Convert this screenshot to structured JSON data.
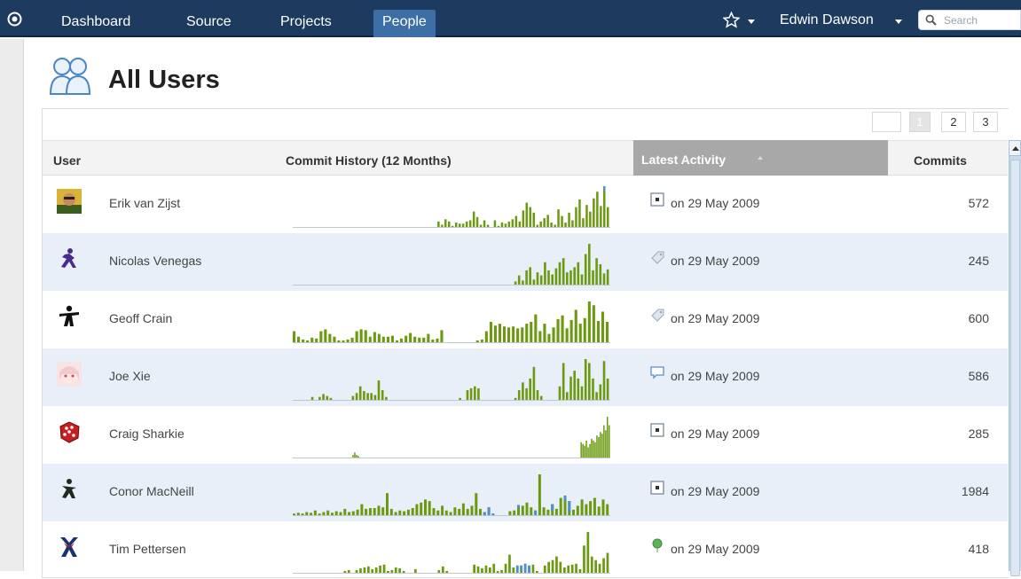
{
  "nav": {
    "items": [
      "Dashboard",
      "Source",
      "Projects",
      "People"
    ],
    "active": "People",
    "user_name": "Edwin Dawson",
    "search_placeholder": "Search"
  },
  "page": {
    "title": "All Users"
  },
  "pagination": {
    "pages": [
      "1",
      "2",
      "3"
    ],
    "current": "1"
  },
  "table": {
    "columns": {
      "user": "User",
      "history": "Commit History (12 Months)",
      "activity": "Latest Activity",
      "commits": "Commits"
    },
    "sorted_by": "Latest Activity",
    "rows": [
      {
        "name": "Erik van Zijst",
        "avatar": "photo-avatar",
        "activity_icon": "commit-icon",
        "activity": "on 29 May 2009",
        "commits": "572",
        "history": [
          0,
          0,
          0,
          0,
          0,
          0,
          0,
          0,
          0,
          0,
          0,
          0,
          0,
          0,
          0,
          0,
          0,
          0,
          0,
          0,
          0,
          0,
          0,
          0,
          0,
          0,
          0,
          0,
          0,
          0,
          0,
          0,
          0,
          0,
          0,
          0,
          0,
          0,
          0,
          0,
          0,
          5,
          2,
          7,
          5,
          1,
          4,
          3,
          3,
          5,
          6,
          14,
          9,
          2,
          6,
          2,
          0,
          6,
          1,
          4,
          3,
          5,
          7,
          10,
          5,
          15,
          22,
          18,
          13,
          2,
          5,
          8,
          11,
          4,
          2,
          16,
          10,
          4,
          13,
          6,
          18,
          25,
          8,
          20,
          14,
          26,
          32,
          19,
          37,
          18
        ],
        "highlight": {
          "88": 4
        }
      },
      {
        "name": "Nicolas Venegas",
        "avatar": "figure-purple-avatar",
        "activity_icon": "tag-icon",
        "activity": "on 29 May 2009",
        "commits": "245",
        "history": [
          0,
          0,
          0,
          0,
          0,
          0,
          0,
          0,
          0,
          0,
          0,
          0,
          0,
          0,
          0,
          0,
          0,
          0,
          0,
          0,
          0,
          0,
          0,
          0,
          0,
          0,
          0,
          0,
          0,
          0,
          0,
          0,
          0,
          0,
          0,
          0,
          0,
          0,
          0,
          0,
          0,
          0,
          0,
          0,
          0,
          0,
          0,
          0,
          0,
          0,
          0,
          0,
          0,
          0,
          0,
          0,
          0,
          0,
          0,
          0,
          3,
          9,
          4,
          14,
          17,
          5,
          12,
          9,
          22,
          14,
          10,
          16,
          22,
          26,
          12,
          14,
          17,
          22,
          10,
          30,
          40,
          14,
          26,
          20,
          11,
          15
        ],
        "highlight": {}
      },
      {
        "name": "Geoff Crain",
        "avatar": "figure-black-avatar",
        "activity_icon": "tag-icon",
        "activity": "on 29 May 2009",
        "commits": "600",
        "history": [
          12,
          6,
          3,
          2,
          5,
          4,
          12,
          14,
          9,
          6,
          2,
          2,
          3,
          5,
          12,
          14,
          13,
          6,
          11,
          9,
          6,
          6,
          7,
          2,
          4,
          7,
          10,
          6,
          5,
          5,
          9,
          3,
          4,
          13,
          0,
          0,
          0,
          0,
          0,
          0,
          0,
          2,
          3,
          12,
          22,
          18,
          20,
          17,
          16,
          17,
          15,
          16,
          20,
          22,
          30,
          12,
          20,
          9,
          16,
          25,
          29,
          15,
          24,
          35,
          20,
          26,
          44,
          40,
          23,
          33,
          22
        ],
        "highlight": {}
      },
      {
        "name": "Joe Xie",
        "avatar": "anime-avatar",
        "activity_icon": "comment-icon",
        "activity": "on 29 May 2009",
        "commits": "586",
        "history": [
          0,
          0,
          0,
          0,
          0,
          3,
          0,
          3,
          6,
          4,
          2,
          0,
          0,
          0,
          0,
          0,
          4,
          7,
          14,
          9,
          7,
          7,
          5,
          20,
          10,
          3,
          0,
          0,
          0,
          0,
          0,
          0,
          0,
          0,
          0,
          0,
          0,
          0,
          0,
          0,
          0,
          0,
          0,
          0,
          0,
          2,
          0,
          10,
          12,
          14,
          12,
          0,
          0,
          0,
          0,
          0,
          0,
          0,
          0,
          0,
          2,
          10,
          18,
          12,
          22,
          34,
          10,
          4,
          0,
          0,
          0,
          0,
          14,
          38,
          8,
          24,
          30,
          22,
          14,
          42,
          38,
          22,
          8,
          16,
          40,
          22
        ],
        "highlight": {}
      },
      {
        "name": "Craig Sharkie",
        "avatar": "dice-avatar",
        "activity_icon": "commit-icon",
        "activity": "on 29 May 2009",
        "commits": "285",
        "history": [
          0,
          0,
          0,
          0,
          0,
          0,
          0,
          0,
          0,
          0,
          0,
          0,
          0,
          0,
          0,
          0,
          0,
          0,
          0,
          0,
          0,
          0,
          0,
          0,
          0,
          0,
          0,
          0,
          0,
          0,
          0,
          0,
          0,
          0,
          3,
          6,
          3,
          2,
          0,
          0,
          0,
          0,
          0,
          0,
          0,
          0,
          0,
          0,
          0,
          0,
          0,
          0,
          0,
          0,
          0,
          0,
          0,
          0,
          0,
          0,
          0,
          0,
          0,
          0,
          0,
          0,
          0,
          0,
          0,
          0,
          0,
          0,
          0,
          0,
          0,
          0,
          0,
          0,
          0,
          0,
          0,
          0,
          0,
          0,
          0,
          0,
          0,
          0,
          0,
          0,
          0,
          0,
          0,
          0,
          0,
          0,
          0,
          0,
          0,
          0,
          0,
          0,
          0,
          0,
          0,
          0,
          0,
          0,
          0,
          0,
          0,
          0,
          0,
          0,
          0,
          0,
          0,
          0,
          0,
          0,
          0,
          0,
          0,
          0,
          0,
          0,
          0,
          0,
          0,
          0,
          0,
          0,
          0,
          0,
          0,
          0,
          0,
          0,
          0,
          0,
          0,
          0,
          0,
          0,
          0,
          0,
          0,
          0,
          0,
          0,
          0,
          0,
          0,
          0,
          0,
          0,
          0,
          0,
          0,
          0,
          0,
          0,
          0,
          0,
          18,
          16,
          14,
          20,
          12,
          16,
          22,
          20,
          18,
          26,
          24,
          30,
          28,
          38,
          32,
          48,
          38
        ],
        "highlight": {}
      },
      {
        "name": "Conor MacNeill",
        "avatar": "figure-dark-avatar",
        "activity_icon": "commit-icon",
        "activity": "on 29 May 2009",
        "commits": "1984",
        "history": [
          2,
          3,
          2,
          4,
          3,
          6,
          2,
          4,
          6,
          3,
          5,
          4,
          8,
          4,
          5,
          7,
          14,
          8,
          9,
          9,
          12,
          10,
          28,
          8,
          4,
          6,
          5,
          7,
          9,
          14,
          16,
          20,
          18,
          9,
          6,
          12,
          6,
          4,
          10,
          8,
          15,
          8,
          12,
          28,
          8,
          4,
          10,
          2,
          0,
          0,
          0,
          5,
          6,
          13,
          12,
          16,
          10,
          6,
          52,
          10,
          7,
          14,
          8,
          22,
          25,
          18,
          7,
          12,
          20,
          14,
          18,
          22,
          11,
          20,
          14
        ],
        "highlight": {
          "45": 6,
          "46": 10,
          "47": 8,
          "48": 6,
          "49": 6,
          "53": 4,
          "57": 22,
          "61": 8,
          "64": 6,
          "65": 14
        }
      },
      {
        "name": "Tim Pettersen",
        "avatar": "figure-red-avatar",
        "activity_icon": "milestone-icon",
        "activity": "on 29 May 2009",
        "commits": "418",
        "history": [
          0,
          0,
          0,
          0,
          0,
          0,
          0,
          0,
          0,
          0,
          0,
          0,
          0,
          2,
          3,
          0,
          3,
          5,
          6,
          7,
          4,
          6,
          8,
          9,
          2,
          3,
          6,
          5,
          2,
          0,
          0,
          4,
          0,
          0,
          0,
          0,
          0,
          3,
          7,
          2,
          0,
          0,
          0,
          0,
          0,
          0,
          9,
          7,
          5,
          8,
          6,
          10,
          2,
          3,
          10,
          20,
          6,
          8,
          8,
          10,
          8,
          9,
          2,
          0,
          8,
          12,
          14,
          18,
          12,
          6,
          8,
          9,
          10,
          4,
          30,
          45,
          18,
          14,
          10,
          16,
          22
        ],
        "highlight": {
          "57": 8,
          "58": 6,
          "59": 10,
          "60": 8
        }
      }
    ]
  },
  "colors": {
    "nav_bg": "#1d3a5f",
    "nav_active": "#3d6ea5",
    "bar": "#6b9a10",
    "bar_highlight": "#4d8fcf",
    "row_alt": "#e8eff8",
    "sorted_header": "#a8a8a8"
  }
}
